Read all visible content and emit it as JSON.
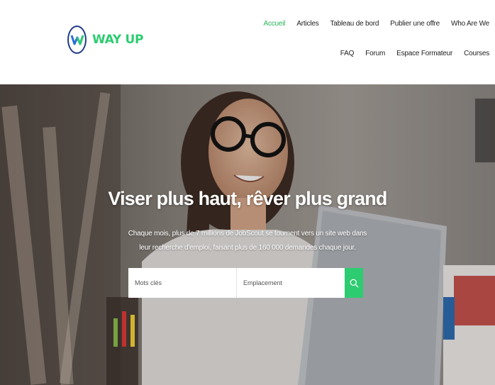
{
  "brand": {
    "name": "WAY UP",
    "logo_letter": "W"
  },
  "nav": {
    "row1": [
      "Accueil",
      "Articles",
      "Tableau de bord",
      "Publier une offre",
      "Who Are We"
    ],
    "row2": [
      "FAQ",
      "Forum",
      "Espace Formateur",
      "Courses"
    ],
    "active": "Accueil"
  },
  "hero": {
    "title": "Viser plus haut, rêver plus grand",
    "subtitle": "Chaque mois, plus de 7 millions de JobScout se tournent vers un site web dans leur recherche d'emploi, faisant plus de 160 000 demandes chaque jour."
  },
  "search": {
    "keywords_placeholder": "Mots clés",
    "location_placeholder": "Emplacement",
    "button_icon": "search-icon"
  },
  "colors": {
    "accent": "#2ecc71",
    "logo_ring": "#1f3b8a",
    "text": "#1f1f1f"
  }
}
